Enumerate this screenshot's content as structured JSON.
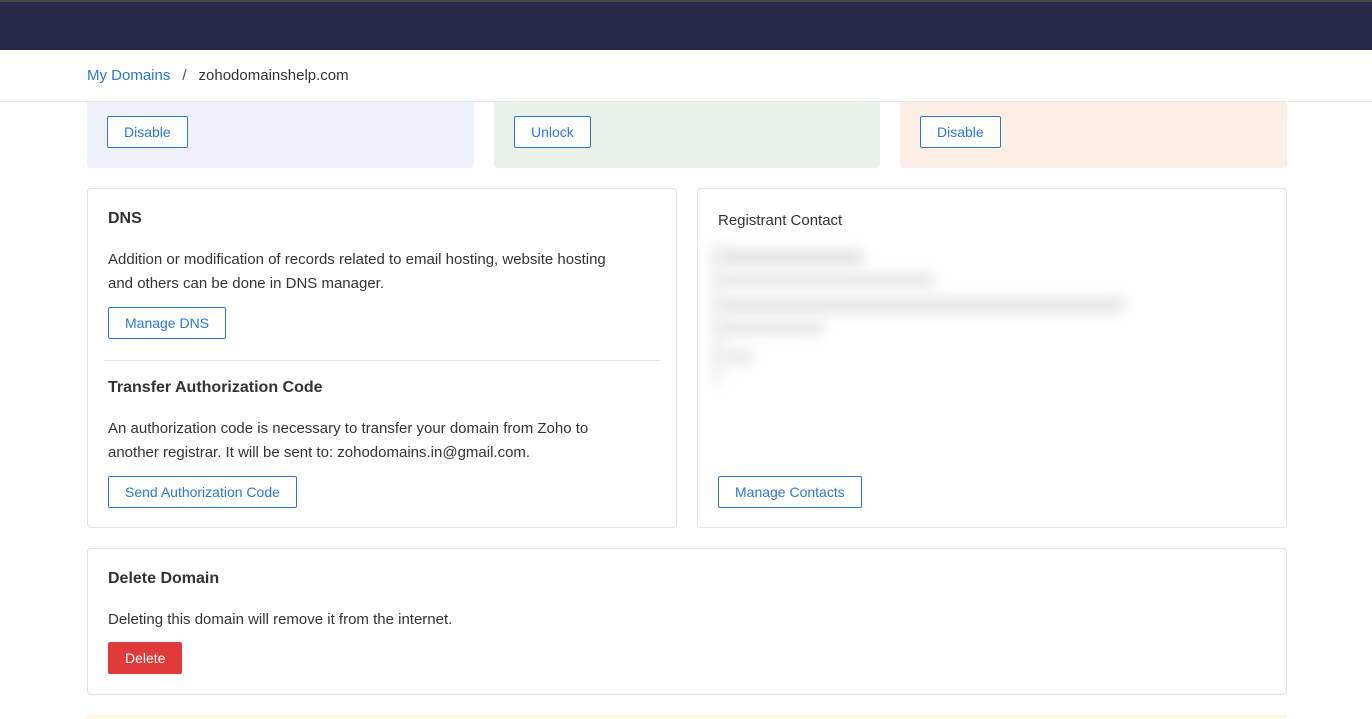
{
  "breadcrumb": {
    "root_label": "My Domains",
    "separator": "/",
    "current": "zohodomainshelp.com"
  },
  "top_cards": [
    {
      "button_label": "Disable",
      "bg": "#eff1fd"
    },
    {
      "button_label": "Unlock",
      "bg": "#e9f2e8"
    },
    {
      "button_label": "Disable",
      "bg": "#fdeee6"
    }
  ],
  "dns": {
    "title": "DNS",
    "description_line1": "Addition or modification of records related to email hosting, website hosting",
    "description_line2": "and others can be done in DNS manager.",
    "button_label": "Manage DNS"
  },
  "transfer": {
    "title": "Transfer Authorization Code",
    "description_line1": "An authorization code is necessary to transfer your domain from Zoho to",
    "description_line2": "another registrar. It will be sent to: zohodomains.in@gmail.com.",
    "button_label": "Send Authorization Code"
  },
  "registrant": {
    "title": "Registrant Contact",
    "button_label": "Manage Contacts"
  },
  "delete_domain": {
    "title": "Delete Domain",
    "description": "Deleting this domain will remove it from the internet.",
    "button_label": "Delete"
  },
  "colors": {
    "topbar": "#252a48",
    "link": "#2a78d6",
    "danger": "#e03a3a"
  }
}
